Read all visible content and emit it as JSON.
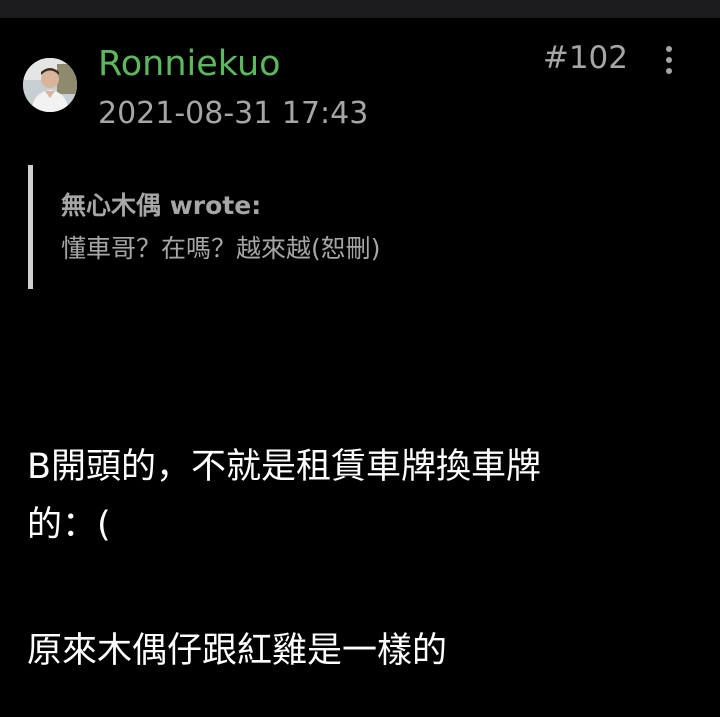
{
  "post": {
    "username": "Ronniekuo",
    "timestamp": "2021-08-31 17:43",
    "post_number": "#102",
    "more_icon": "more-vertical-icon",
    "quote": {
      "author": "無心木偶 wrote:",
      "text": "懂車哥？在嗎？越來越(恕刪)"
    },
    "body": [
      "B開頭的，不就是租賃車牌換車牌",
      "的：(",
      "原來木偶仔跟紅雞是一樣的"
    ]
  },
  "colors": {
    "background": "#000000",
    "username": "#5cb85c",
    "meta_text": "#a6a6a6",
    "body_text": "#ffffff",
    "quote_bar": "#d0d0d0"
  }
}
